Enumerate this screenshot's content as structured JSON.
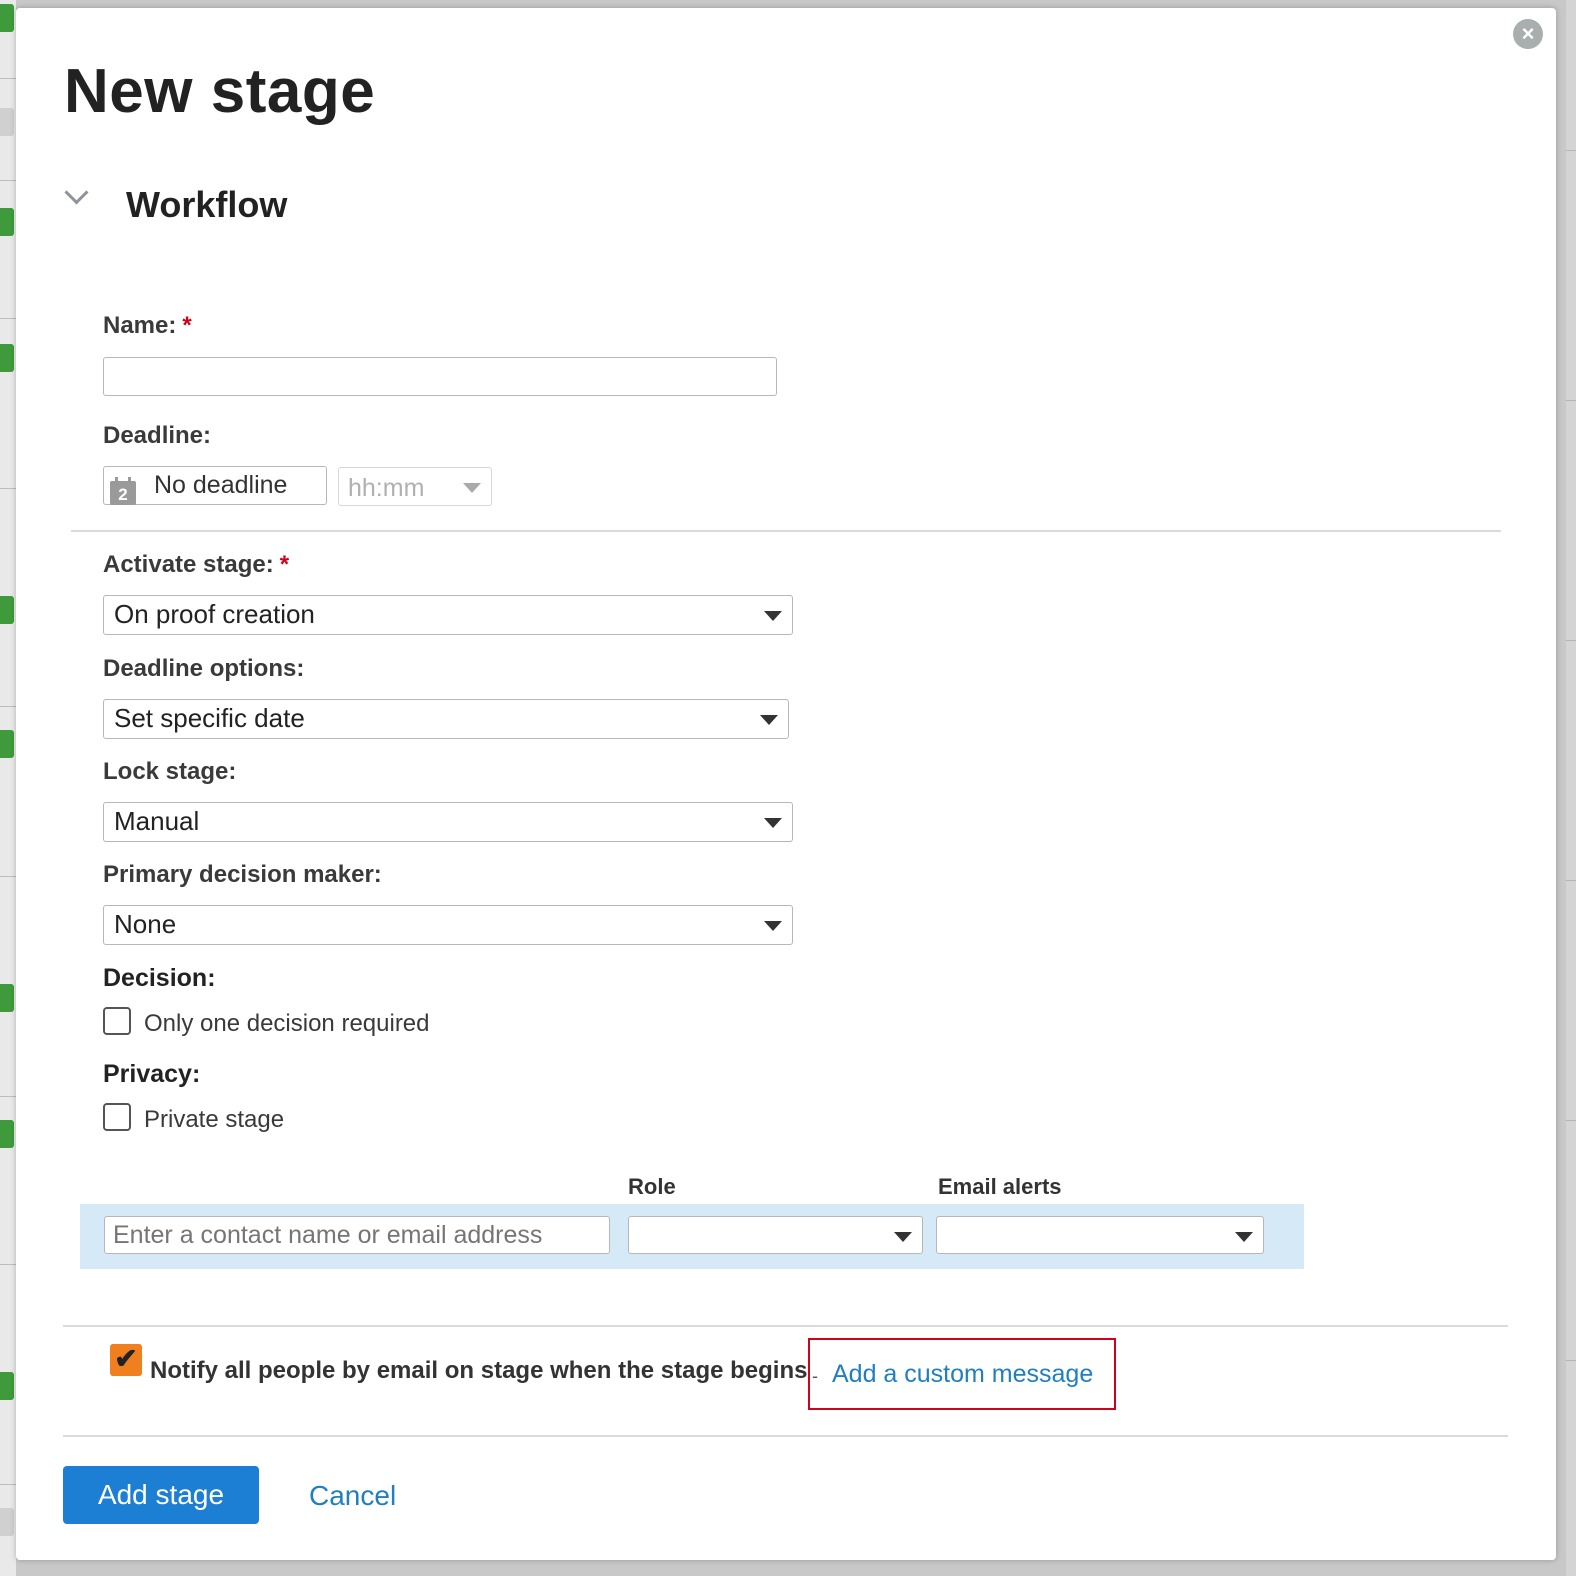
{
  "dialog": {
    "title": "New stage",
    "close_icon": "close-icon",
    "section": {
      "title": "Workflow",
      "toggle_icon": "chevron-down-icon"
    }
  },
  "form": {
    "name": {
      "label": "Name:",
      "required_mark": "*",
      "value": ""
    },
    "deadline": {
      "label": "Deadline:",
      "date_value": "No deadline",
      "calendar_icon": "calendar-icon",
      "calendar_day": "2",
      "time_placeholder": "hh:mm"
    },
    "activate_stage": {
      "label": "Activate stage:",
      "required_mark": "*",
      "value": "On proof creation"
    },
    "deadline_options": {
      "label": "Deadline options:",
      "value": "Set specific date"
    },
    "lock_stage": {
      "label": "Lock stage:",
      "value": "Manual"
    },
    "primary_decision_maker": {
      "label": "Primary decision maker:",
      "value": "None"
    },
    "decision": {
      "label": "Decision:",
      "checkbox_label": "Only one decision required",
      "checked": false
    },
    "privacy": {
      "label": "Privacy:",
      "checkbox_label": "Private stage",
      "checked": false
    }
  },
  "contacts": {
    "role_header": "Role",
    "email_alerts_header": "Email alerts",
    "contact_placeholder": "Enter a contact name or email address",
    "role_value": "",
    "email_alerts_value": ""
  },
  "notify": {
    "checked": true,
    "check_glyph": "✔",
    "label": "Notify all people by email on stage when the stage begins",
    "separator": "-",
    "custom_message_link": "Add a custom message"
  },
  "actions": {
    "add_stage": "Add stage",
    "cancel": "Cancel"
  },
  "colors": {
    "primary_button": "#1d7fd3",
    "link": "#1f7fbf",
    "required": "#d0021b",
    "notify_checkbox": "#f07f1f",
    "contact_row_bg": "#d5eaf6",
    "highlight_border": "#d0021b"
  }
}
